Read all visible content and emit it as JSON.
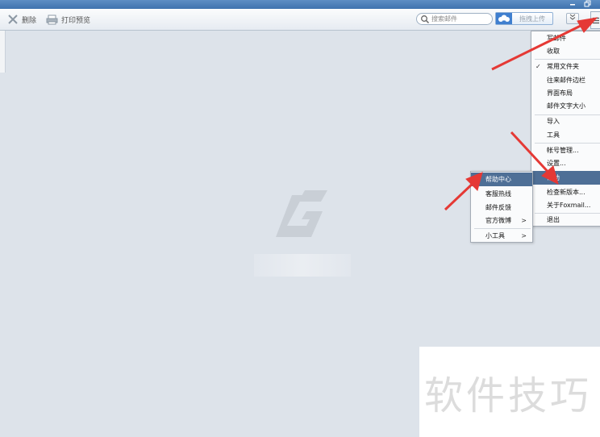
{
  "toolbar": {
    "delete_label": "删除",
    "print_label": "打印预览",
    "search_placeholder": "搜索邮件",
    "upload_label": "拖拽上传",
    "expand_icon": "chevron-double-down-icon",
    "menu_icon": "menu-icon"
  },
  "main_menu": {
    "items": [
      {
        "label": "写邮件"
      },
      {
        "label": "收取"
      },
      {
        "label": "常用文件夹",
        "checked": true
      },
      {
        "label": "往来邮件边栏"
      },
      {
        "label": "界面布局"
      },
      {
        "label": "邮件文字大小"
      },
      {
        "label": "导入"
      },
      {
        "label": "工具"
      },
      {
        "label": "帐号管理..."
      },
      {
        "label": "设置..."
      },
      {
        "label": "帮助",
        "selected": true
      },
      {
        "label": "检查新版本..."
      },
      {
        "label": "关于Foxmail..."
      },
      {
        "label": "退出"
      }
    ]
  },
  "help_submenu": {
    "items": [
      {
        "label": "帮助中心",
        "selected": true
      },
      {
        "label": "客服热线"
      },
      {
        "label": "邮件反馈"
      },
      {
        "label": "官方微博",
        "has_submenu": true
      },
      {
        "label": "小工具",
        "has_submenu": true
      }
    ]
  },
  "watermark": {
    "text": "软件技巧"
  },
  "colors": {
    "accent": "#4e6f96",
    "arrow": "#e53935",
    "titlebar": "#4a7fbd",
    "content_bg": "#dde3ea"
  }
}
